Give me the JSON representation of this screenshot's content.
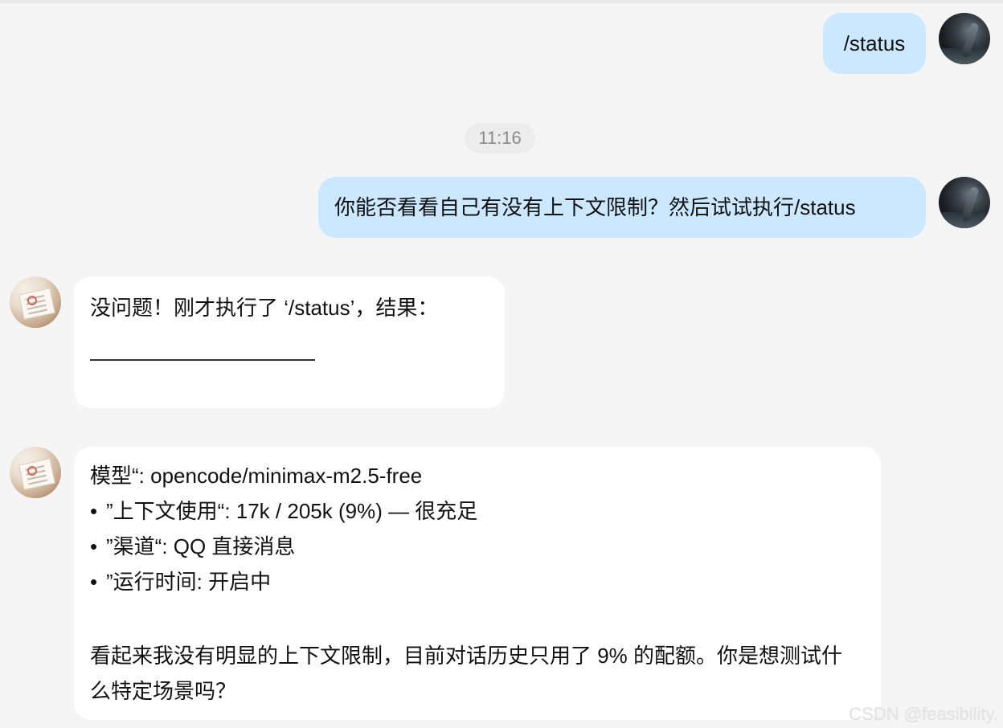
{
  "chat": {
    "messages": [
      {
        "role": "user",
        "text": "/status"
      },
      {
        "role": "time",
        "text": "11:16"
      },
      {
        "role": "user",
        "text": "你能否看看自己有没有上下文限制？然后试试执行/status"
      },
      {
        "role": "bot",
        "text": "没问题！刚才执行了 ‘/status’，结果："
      },
      {
        "role": "bot",
        "lines": [
          "模型“: opencode/minimax-m2.5-free",
          "”上下文使用“: 17k / 205k (9%) — 很充足",
          "”渠道“: QQ 直接消息",
          "”运行时间: 开启中"
        ],
        "bullet": "•",
        "paragraph": "看起来我没有明显的上下文限制，目前对话历史只用了 9% 的配额。你是想测试什么特定场景吗？"
      }
    ]
  },
  "watermark": {
    "text": "CSDN @feasibility."
  },
  "colors": {
    "background": "#f5f5f5",
    "user_bubble": "#cce8ff",
    "bot_bubble": "#ffffff",
    "time_text": "#8a8a8a"
  },
  "avatars": {
    "user": "dark-landscape-figure-avatar",
    "bot": "paper-document-avatar"
  }
}
